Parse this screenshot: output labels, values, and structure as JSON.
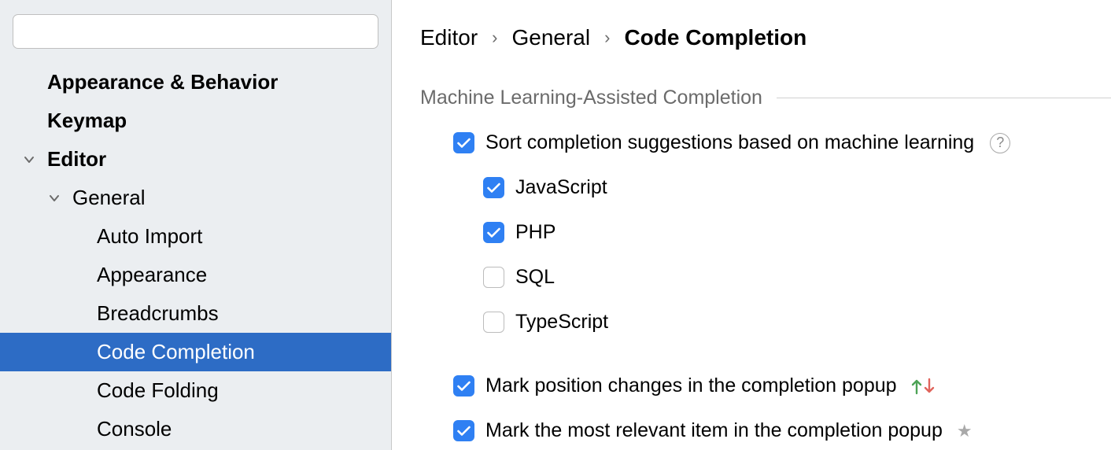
{
  "search": {
    "placeholder": ""
  },
  "sidebar": {
    "items": [
      {
        "label": "Appearance & Behavior",
        "bold": true,
        "level": 0,
        "expandable": false,
        "selected": false
      },
      {
        "label": "Keymap",
        "bold": true,
        "level": 0,
        "expandable": false,
        "selected": false
      },
      {
        "label": "Editor",
        "bold": true,
        "level": 0,
        "expandable": true,
        "selected": false
      },
      {
        "label": "General",
        "bold": false,
        "level": 1,
        "expandable": true,
        "selected": false
      },
      {
        "label": "Auto Import",
        "bold": false,
        "level": 2,
        "expandable": false,
        "selected": false
      },
      {
        "label": "Appearance",
        "bold": false,
        "level": 2,
        "expandable": false,
        "selected": false
      },
      {
        "label": "Breadcrumbs",
        "bold": false,
        "level": 2,
        "expandable": false,
        "selected": false
      },
      {
        "label": "Code Completion",
        "bold": false,
        "level": 2,
        "expandable": false,
        "selected": true
      },
      {
        "label": "Code Folding",
        "bold": false,
        "level": 2,
        "expandable": false,
        "selected": false
      },
      {
        "label": "Console",
        "bold": false,
        "level": 2,
        "expandable": false,
        "selected": false
      }
    ]
  },
  "breadcrumb": {
    "items": [
      "Editor",
      "General",
      "Code Completion"
    ]
  },
  "section": {
    "title": "Machine Learning-Assisted Completion"
  },
  "options": {
    "sort_ml": {
      "label": "Sort completion suggestions based on machine learning",
      "checked": true
    },
    "langs": [
      {
        "label": "JavaScript",
        "checked": true
      },
      {
        "label": "PHP",
        "checked": true
      },
      {
        "label": "SQL",
        "checked": false
      },
      {
        "label": "TypeScript",
        "checked": false
      }
    ],
    "mark_position": {
      "label": "Mark position changes in the completion popup",
      "checked": true
    },
    "mark_relevant": {
      "label": "Mark the most relevant item in the completion popup",
      "checked": true
    }
  }
}
